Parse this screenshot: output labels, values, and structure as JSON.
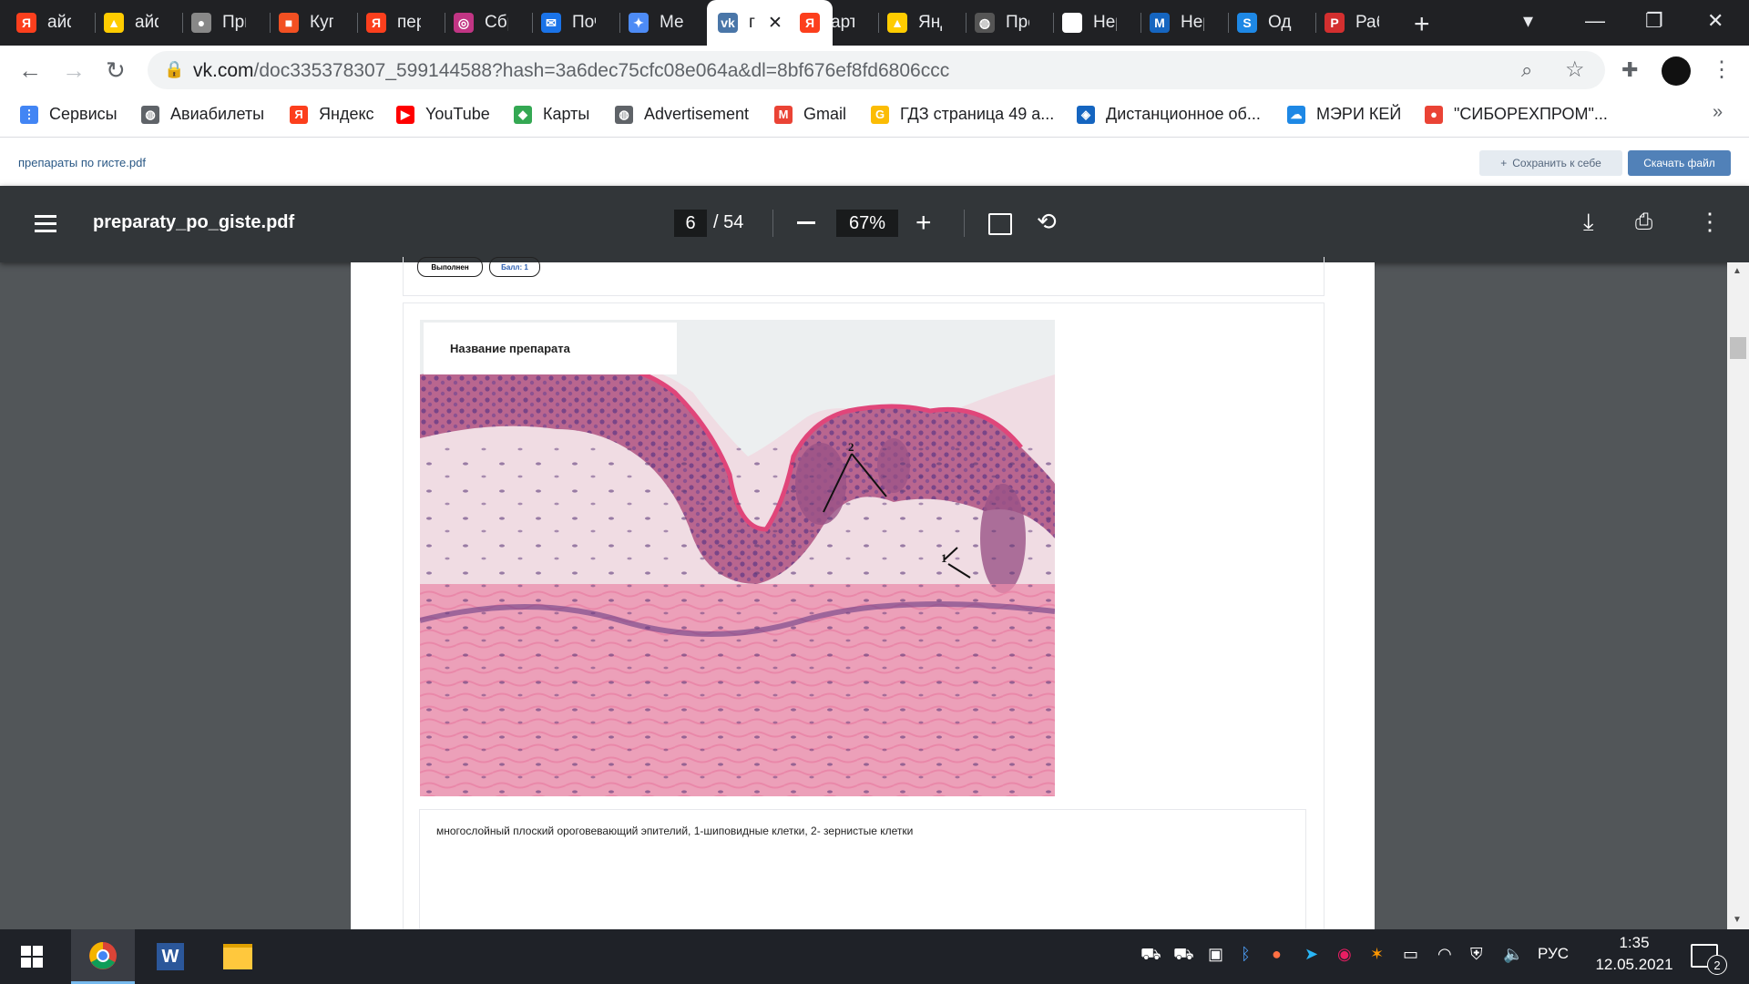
{
  "browser": {
    "tabs": [
      {
        "label": "айф",
        "icon": "yandex-icon",
        "color": "#fc3f1d"
      },
      {
        "label": "айф",
        "icon": "image-icon",
        "color": "#ffcc00"
      },
      {
        "label": "При",
        "icon": "apple-icon",
        "color": "#888888"
      },
      {
        "label": "Купи",
        "icon": "microsoft-icon",
        "color": "#f25022"
      },
      {
        "label": "пер",
        "icon": "yandex-icon",
        "color": "#fc3f1d"
      },
      {
        "label": "Сбр",
        "icon": "instagram-icon",
        "color": "#c13584"
      },
      {
        "label": "Поч",
        "icon": "mail-icon",
        "color": "#1a73e8"
      },
      {
        "label": "Мес",
        "icon": "messenger-icon",
        "color": "#4d8bf5"
      },
      {
        "label": "г",
        "icon": "vk-icon",
        "color": "#4a76a8",
        "active": true
      },
      {
        "label": "арте",
        "icon": "yandex-icon",
        "color": "#fc3f1d"
      },
      {
        "label": "Янд",
        "icon": "image-icon",
        "color": "#ffcc00"
      },
      {
        "label": "Пре",
        "icon": "globe-icon",
        "color": "#555555"
      },
      {
        "label": "Нер",
        "icon": "doc-icon",
        "color": "#ffffff"
      },
      {
        "label": "Нер",
        "icon": "m-icon",
        "color": "#1565c0"
      },
      {
        "label": "Одн",
        "icon": "s-icon",
        "color": "#1e88e5"
      },
      {
        "label": "Рабо",
        "icon": "p-icon",
        "color": "#d32f2f"
      }
    ],
    "url_main": "vk.com",
    "url_rest": "/doc335378307_599144588?hash=3a6dec75cfc08e064a&dl=8bf676ef8fd6806ccc",
    "bookmarks": [
      {
        "label": "Сервисы",
        "icon": "apps-icon",
        "color": "#4285f4"
      },
      {
        "label": "Авиабилеты",
        "icon": "globe-icon",
        "color": "#5f6368"
      },
      {
        "label": "Яндекс",
        "icon": "yandex-icon",
        "color": "#fc3f1d"
      },
      {
        "label": "YouTube",
        "icon": "youtube-icon",
        "color": "#ff0000"
      },
      {
        "label": "Карты",
        "icon": "maps-icon",
        "color": "#34a853"
      },
      {
        "label": "Advertisement",
        "icon": "globe-icon",
        "color": "#5f6368"
      },
      {
        "label": "Gmail",
        "icon": "gmail-icon",
        "color": "#ea4335"
      },
      {
        "label": "ГДЗ страница 49 а...",
        "icon": "gdz-icon",
        "color": "#fbbc05"
      },
      {
        "label": "Дистанционное об...",
        "icon": "edu-icon",
        "color": "#1565c0"
      },
      {
        "label": "МЭРИ КЕЙ",
        "icon": "cloud-icon",
        "color": "#1e88e5"
      },
      {
        "label": "\"СИБОРЕХПРОМ\"...",
        "icon": "dots-icon",
        "color": "#ea4335"
      }
    ]
  },
  "vk": {
    "doc_title": "препараты по гисте.pdf",
    "save_label": "Сохранить к себе",
    "download_label": "Скачать файл"
  },
  "pdf": {
    "filename": "preparaty_po_giste.pdf",
    "page": "6",
    "total": "/ 54",
    "zoom": "67%",
    "status_pill": "Выполнен",
    "score_pill": "Балл: 1",
    "prep_label": "Название препарата",
    "marker_1": "1",
    "marker_2": "2",
    "answer": "многослойный плоский ороговевающий эпителий, 1-шиповидные клетки, 2- зернистые клетки"
  },
  "taskbar": {
    "lang": "РУС",
    "time": "1:35",
    "date": "12.05.2021",
    "notif_count": "2"
  }
}
